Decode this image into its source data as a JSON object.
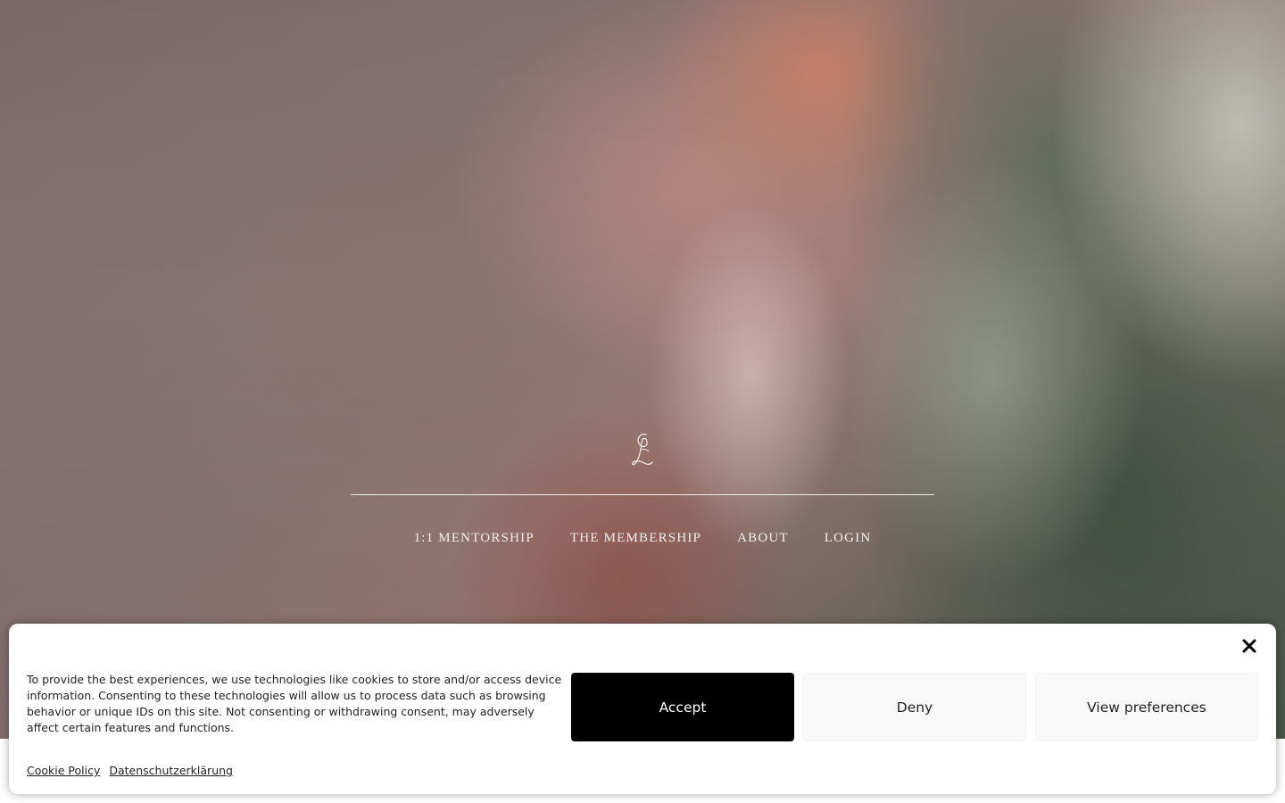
{
  "brand": {
    "logo_icon": "script-l-monogram-icon"
  },
  "nav": {
    "items": [
      {
        "label": "1:1 MENTORSHIP"
      },
      {
        "label": "THE MEMBERSHIP"
      },
      {
        "label": "ABOUT"
      },
      {
        "label": "LOGIN"
      }
    ]
  },
  "cookie_banner": {
    "message": "To provide the best experiences, we use technologies like cookies to store and/or access device information. Consenting to these technologies will allow us to process data such as browsing behavior or unique IDs on this site. Not consenting or withdrawing consent, may adversely affect certain features and functions.",
    "accept_label": "Accept",
    "deny_label": "Deny",
    "preferences_label": "View preferences",
    "close_icon": "close-icon",
    "links": [
      {
        "label": "Cookie Policy"
      },
      {
        "label": "Datenschutzerklärung"
      }
    ]
  },
  "colors": {
    "accept_bg": "#000000",
    "secondary_bg": "#f9f9f9",
    "nav_text": "#f4efee"
  }
}
